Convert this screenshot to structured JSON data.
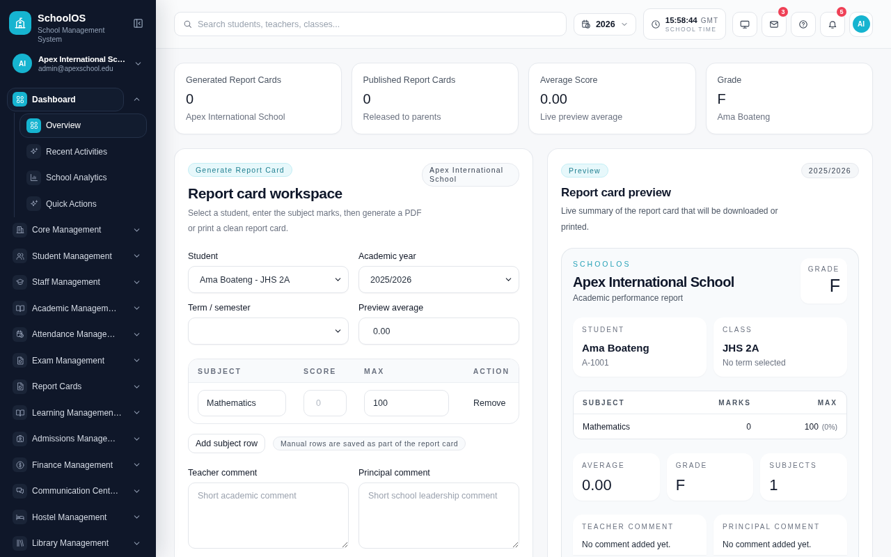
{
  "sidebar": {
    "brand": {
      "name": "SchoolOS",
      "tagline": "School Management System"
    },
    "account": {
      "initials": "AI",
      "name": "Apex International Sc…",
      "email": "admin@apexschool.edu"
    },
    "nav": [
      {
        "label": "Dashboard",
        "selected": true,
        "expanded": true,
        "children": [
          {
            "label": "Overview",
            "selected": true
          },
          {
            "label": "Recent Activities",
            "selected": false
          },
          {
            "label": "School Analytics",
            "selected": false
          },
          {
            "label": "Quick Actions",
            "selected": false
          }
        ]
      },
      {
        "label": "Core Management",
        "selected": false,
        "expanded": false
      },
      {
        "label": "Student Management",
        "selected": false,
        "expanded": false
      },
      {
        "label": "Staff Management",
        "selected": false,
        "expanded": false
      },
      {
        "label": "Academic Managem…",
        "selected": false,
        "expanded": false
      },
      {
        "label": "Attendance Manage…",
        "selected": false,
        "expanded": false
      },
      {
        "label": "Exam Management",
        "selected": false,
        "expanded": false
      },
      {
        "label": "Report Cards",
        "selected": false,
        "expanded": false
      },
      {
        "label": "Learning Managemen…",
        "selected": false,
        "expanded": false
      },
      {
        "label": "Admissions Manage…",
        "selected": false,
        "expanded": false
      },
      {
        "label": "Finance Management",
        "selected": false,
        "expanded": false
      },
      {
        "label": "Communication Cent…",
        "selected": false,
        "expanded": false
      },
      {
        "label": "Hostel Management",
        "selected": false,
        "expanded": false
      },
      {
        "label": "Library Management",
        "selected": false,
        "expanded": false
      }
    ]
  },
  "topbar": {
    "search": {
      "placeholder": "Search students, teachers, classes..."
    },
    "year": "2026",
    "time": "15:58:44",
    "timezone": "GMT",
    "time_label": "SCHOOL TIME",
    "mail_badge": "3",
    "notification_badge": "5",
    "avatar": "AI"
  },
  "stats": [
    {
      "label": "Generated Report Cards",
      "value": "0",
      "note": "Apex International School"
    },
    {
      "label": "Published Report Cards",
      "value": "0",
      "note": "Released to parents"
    },
    {
      "label": "Average Score",
      "value": "0.00",
      "note": "Live preview average"
    },
    {
      "label": "Grade",
      "value": "F",
      "note": "Ama Boateng"
    }
  ],
  "workspace": {
    "tag": "Generate Report Card",
    "school": "Apex International School",
    "title": "Report card workspace",
    "description": "Select a student, enter the subject marks, then generate a PDF or print a clean report card.",
    "fields": [
      {
        "kind": "select",
        "label": "Student",
        "value": "Ama Boateng - JHS 2A"
      },
      {
        "kind": "select",
        "label": "Academic year",
        "value": "2025/2026"
      },
      {
        "kind": "select",
        "label": "Term / semester"
      },
      {
        "kind": "input",
        "label": "Preview average",
        "value": "0.00"
      }
    ],
    "table": {
      "columns": [
        "SUBJECT",
        "SCORE",
        "MAX",
        "ACTION"
      ],
      "rows": [
        {
          "subject": "Mathematics",
          "score_placeholder": "0",
          "max": "100",
          "action": "Remove"
        }
      ]
    },
    "add_button": "Add subject row",
    "note": "Manual rows are saved as part of the report card",
    "comments": [
      {
        "label": "Teacher comment",
        "placeholder": "Short academic comment"
      },
      {
        "label": "Principal comment",
        "placeholder": "Short school leadership comment"
      }
    ]
  },
  "preview": {
    "tag": "Preview",
    "year": "2025/2026",
    "title": "Report card preview",
    "description": "Live summary of the report card that will be downloaded or printed.",
    "card": {
      "brand": "SCHOOLOS",
      "school": "Apex International School",
      "subtitle": "Academic performance report",
      "grade_label": "GRADE",
      "grade": "F",
      "info": [
        {
          "label": "STUDENT",
          "value": "Ama Boateng",
          "detail": "A-1001"
        },
        {
          "label": "CLASS",
          "value": "JHS 2A",
          "detail": "No term selected"
        }
      ],
      "table": {
        "columns": [
          "SUBJECT",
          "MARKS",
          "MAX"
        ],
        "rows": [
          {
            "subject": "Mathematics",
            "marks": "0",
            "max": "100",
            "percent": "(0%)"
          }
        ]
      },
      "summary": [
        {
          "label": "AVERAGE",
          "value": "0.00"
        },
        {
          "label": "GRADE",
          "value": "F"
        },
        {
          "label": "SUBJECTS",
          "value": "1"
        }
      ],
      "comments": [
        {
          "label": "TEACHER COMMENT",
          "text": "No comment added yet."
        },
        {
          "label": "PRINCIPAL COMMENT",
          "text": "No comment added yet."
        }
      ]
    }
  }
}
